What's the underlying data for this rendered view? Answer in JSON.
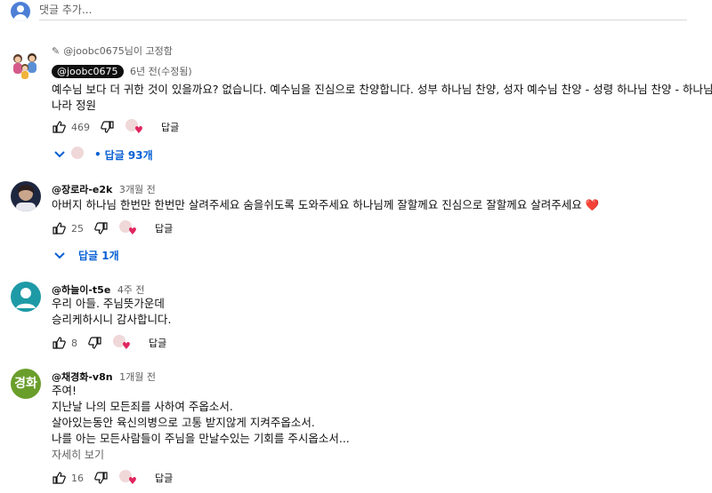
{
  "add_comment": {
    "placeholder": "댓글 추가..."
  },
  "comments": [
    {
      "pinned_label": "@joobc0675님이 고정함",
      "author": "@joobc0675",
      "time": "6년 전(수정됨)",
      "lines": [
        "예수님 보다 더 귀한 것이 있을까요? 없습니다. 예수님을 진심으로 찬양합니다. 성부 하나님 찬양, 성자 예수님 찬양 - 성령 하나님 찬양 - 하나님",
        "나라 정원"
      ],
      "likes": "469",
      "reply_label": "답글",
      "replies_label": "답글 93개"
    },
    {
      "author": "@장로라-e2k",
      "time": "3개월 전",
      "lines": [
        "아버지 하나님 한번만 한번만 살려주세요 숨을쉬도록  도와주세요 하나님께 잘할께요 진심으로 잘할께요 살려주세요 ❤️"
      ],
      "likes": "25",
      "reply_label": "답글",
      "replies_label": "답글 1개"
    },
    {
      "author": "@하늘이-t5e",
      "time": "4주 전",
      "lines": [
        "우리 아들. 주님뜻가운데",
        "승리케하시니 감사합니다."
      ],
      "likes": "8",
      "reply_label": "답글"
    },
    {
      "author": "@채경화-v8n",
      "time": "1개월 전",
      "avatar_text": "경화",
      "lines": [
        "주여!",
        "지난날 나의 모든죄를 사하여 주옵소서.",
        "살아있는동안 육신의병으로  고통 받지않게 지켜주옵소서.",
        "나를 아는 모든사람들이 주님을 만날수있는 기회를 주시옵소서..."
      ],
      "more_label": "자세히 보기",
      "likes": "16",
      "reply_label": "답글"
    }
  ],
  "colors": {
    "link": "#065fd4",
    "heart": "#e0245e",
    "letter_avatar": "#6a9e2b"
  }
}
